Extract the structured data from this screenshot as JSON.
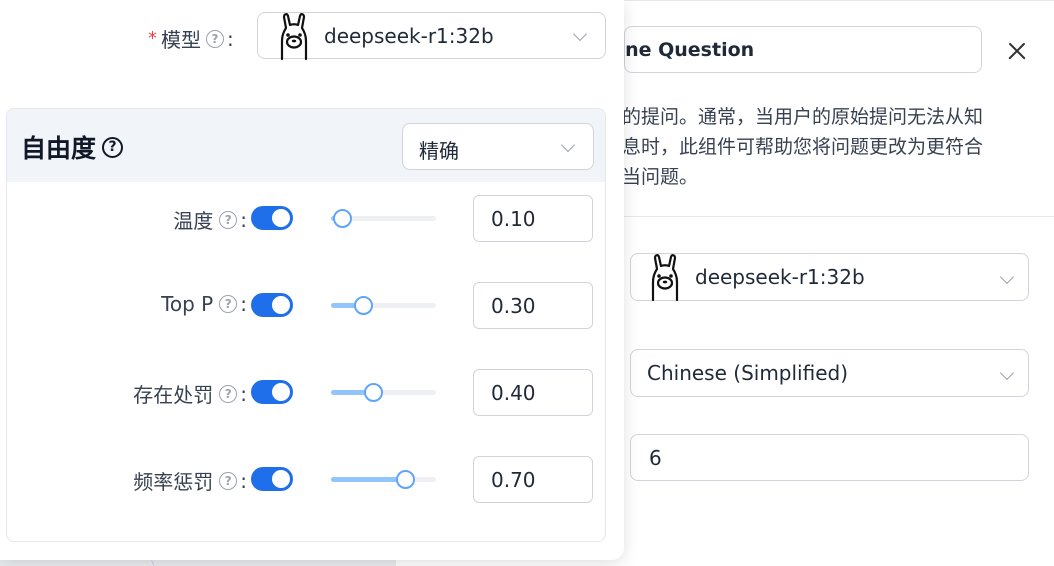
{
  "background_panel": {
    "title_fragment": "fine Question",
    "description_lines": [
      "的提问。通常，当用户的原始提问无法从知",
      "息时，此组件可帮助您将问题更改为更符合",
      "当问题。"
    ],
    "model_value": "deepseek-r1:32b",
    "language_value": "Chinese (Simplified)",
    "number_value": "6"
  },
  "popover": {
    "model": {
      "required_mark": "*",
      "label": "模型",
      "help_glyph": "?",
      "colon": ":",
      "value": "deepseek-r1:32b"
    },
    "freedom": {
      "title": "自由度",
      "help_glyph": "?",
      "preset_value": "精确"
    },
    "params": [
      {
        "label": "温度",
        "enabled": true,
        "value": "0.10",
        "level": 0.1
      },
      {
        "label": "Top P",
        "enabled": true,
        "value": "0.30",
        "level": 0.3
      },
      {
        "label": "存在处罚",
        "enabled": true,
        "value": "0.40",
        "level": 0.4
      },
      {
        "label": "频率惩罚",
        "enabled": true,
        "value": "0.70",
        "level": 0.7
      }
    ]
  },
  "colors": {
    "accent": "#1f6feb",
    "slider_fill": "#93c5fd",
    "required": "#ef4444",
    "header_bg": "#f1f4f9"
  },
  "icons": [
    "llama-icon",
    "help-circle-icon",
    "chevron-down-icon",
    "close-icon"
  ]
}
